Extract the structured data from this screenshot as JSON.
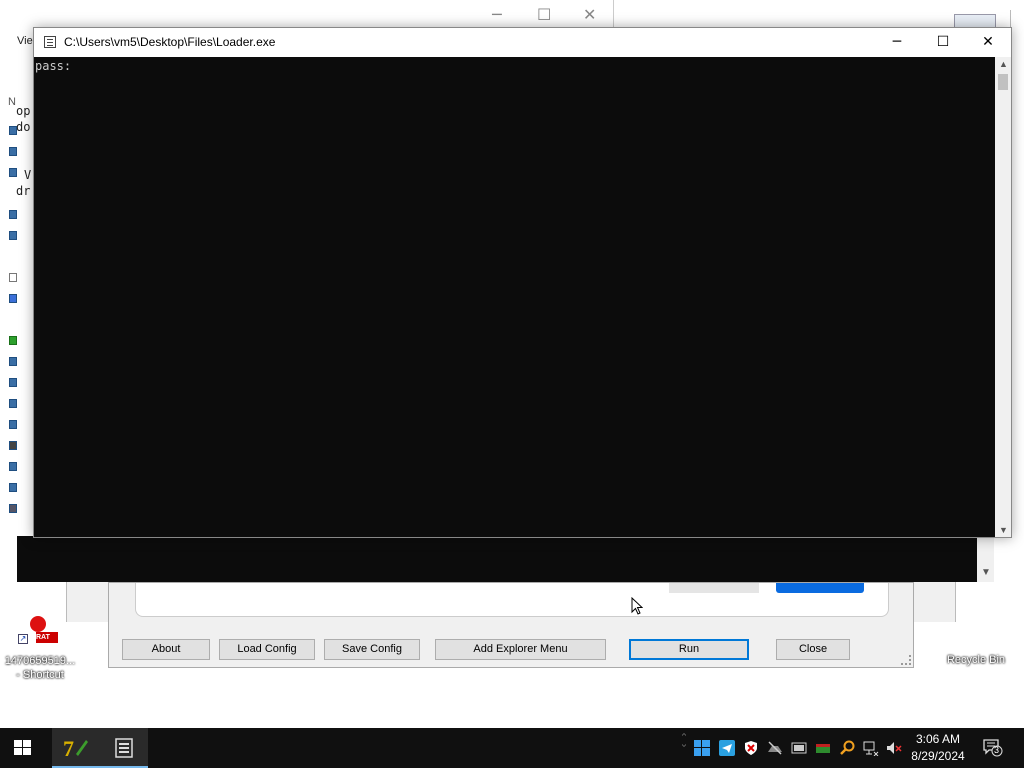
{
  "console": {
    "title": "C:\\Users\\vm5\\Desktop\\Files\\Loader.exe",
    "output_line": "pass:",
    "minimize": "─",
    "maximize": "☐",
    "close": "✕"
  },
  "background_window": {
    "menu_fragment": "Vie",
    "list_text": [
      "op",
      "do",
      "V",
      "dr"
    ],
    "left_label": "N"
  },
  "dialog": {
    "buttons": {
      "about": "About",
      "load_config": "Load Config",
      "save_config": "Save Config",
      "add_explorer_menu": "Add Explorer Menu",
      "run": "Run",
      "close": "Close"
    }
  },
  "desktop": {
    "shortcut_label_line1": "1470659519...",
    "shortcut_label_line2": "- Shortcut",
    "shortcut_badge": "RAT",
    "recycle_bin_label": "Recycle Bin"
  },
  "taskbar": {
    "time": "3:06 AM",
    "date": "8/29/2024",
    "notification_count": "3",
    "pinned": [
      "7-zip-icon",
      "loader-console-icon"
    ],
    "tray_icons": [
      "chevron-up-icon",
      "windows-icon",
      "telegram-icon",
      "defender-icon",
      "network-off-icon",
      "media-icon",
      "battery-icon",
      "search-icon",
      "network-icon",
      "volume-muted-icon"
    ]
  },
  "colors": {
    "console_bg": "#0c0c0c",
    "console_text": "#cccccc",
    "taskbar_bg": "#101010",
    "accent": "#0078d7"
  }
}
